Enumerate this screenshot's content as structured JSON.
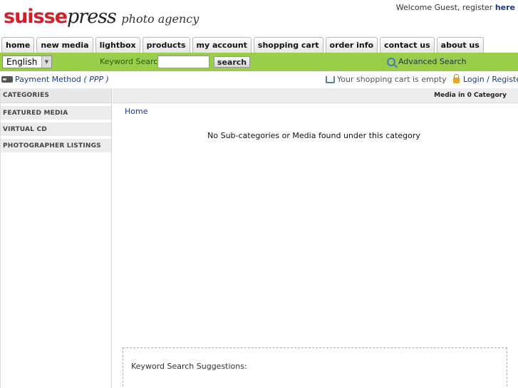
{
  "header": {
    "logo_suisse": "suisse",
    "logo_press": "press",
    "logo_agency": "photo agency",
    "welcome_text": "Welcome Guest, register ",
    "welcome_link": "here"
  },
  "nav": {
    "tabs": [
      {
        "label": "home"
      },
      {
        "label": "new media"
      },
      {
        "label": "lightbox"
      },
      {
        "label": "products"
      },
      {
        "label": "my account"
      },
      {
        "label": "shopping cart"
      },
      {
        "label": "order info"
      },
      {
        "label": "contact us"
      },
      {
        "label": "about us"
      }
    ]
  },
  "searchbar": {
    "language": "English",
    "keyword_label": "Keyword Search",
    "keyword_value": "",
    "search_button": "search",
    "advanced_link": "Advanced Search"
  },
  "infobar": {
    "payment_label": "Payment Method",
    "payment_code": "( PPP )",
    "cart_status": "Your shopping cart is empty",
    "login_link": "Login / Register"
  },
  "sidebar": {
    "heading": "CATEGORIES",
    "items": [
      {
        "label": "FEATURED MEDIA"
      },
      {
        "label": "VIRTUAL CD"
      },
      {
        "label": "PHOTOGRAPHER LISTINGS"
      }
    ]
  },
  "main": {
    "header": "Media in 0 Category",
    "breadcrumb": "Home",
    "empty_message": "No Sub-categories or Media found under this category",
    "suggestions_label": "Keyword Search Suggestions:"
  },
  "colors": {
    "accent_green": "#9acd4a",
    "logo_red": "#d2202a",
    "link_blue": "#1a3a8a"
  }
}
